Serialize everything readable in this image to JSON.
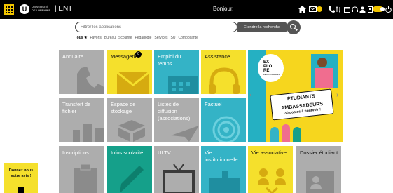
{
  "topbar": {
    "logo_letter": "U",
    "logo_text": "UNIVERSITÉ DE LORRAINE",
    "app_name": "| ENT",
    "greeting": "Bonjour,"
  },
  "search": {
    "placeholder": "Filtrer les applications",
    "extend_label": "Étendre la recherche"
  },
  "filters": [
    "Tous ★",
    "Favoris",
    "Bureau",
    "Scolarité",
    "Pédagogie",
    "Services",
    "SU",
    "Composante"
  ],
  "tiles": {
    "annuaire": "Annuaire",
    "messagerie": "Messagerie",
    "messagerie_badge": "0",
    "emploi": "Emploi du temps",
    "assistance": "Assistance",
    "transfert": "Transfert de fichier",
    "stockage": "Espace de stockage",
    "listes": "Listes de diffusion (associations)",
    "factuel": "Factuel",
    "inscriptions": "Inscriptions",
    "infos": "Infos scolarité",
    "ultv": "ULTV",
    "vie_inst": "Vie institutionnelle",
    "vie_asso": "Vie associative",
    "dossier": "Dossier étudiant"
  },
  "banner": {
    "explore_line1": "EX",
    "explore_line2": "PLO",
    "explore_line3": "RE",
    "explore_line4": "LES POSSIBLES",
    "sign_line1": "ÉTUDIANTS",
    "sign_line2": "AMBASSADEURS",
    "sign_line3": "30 postes à pourvoir !"
  },
  "feedback": {
    "text": "Donnez nous votre avis !"
  },
  "colors": {
    "yellow": "#f5e02c",
    "teal": "#34b3c6",
    "gray": "#adadad",
    "green": "#15a08a",
    "topbar": "#000000"
  }
}
